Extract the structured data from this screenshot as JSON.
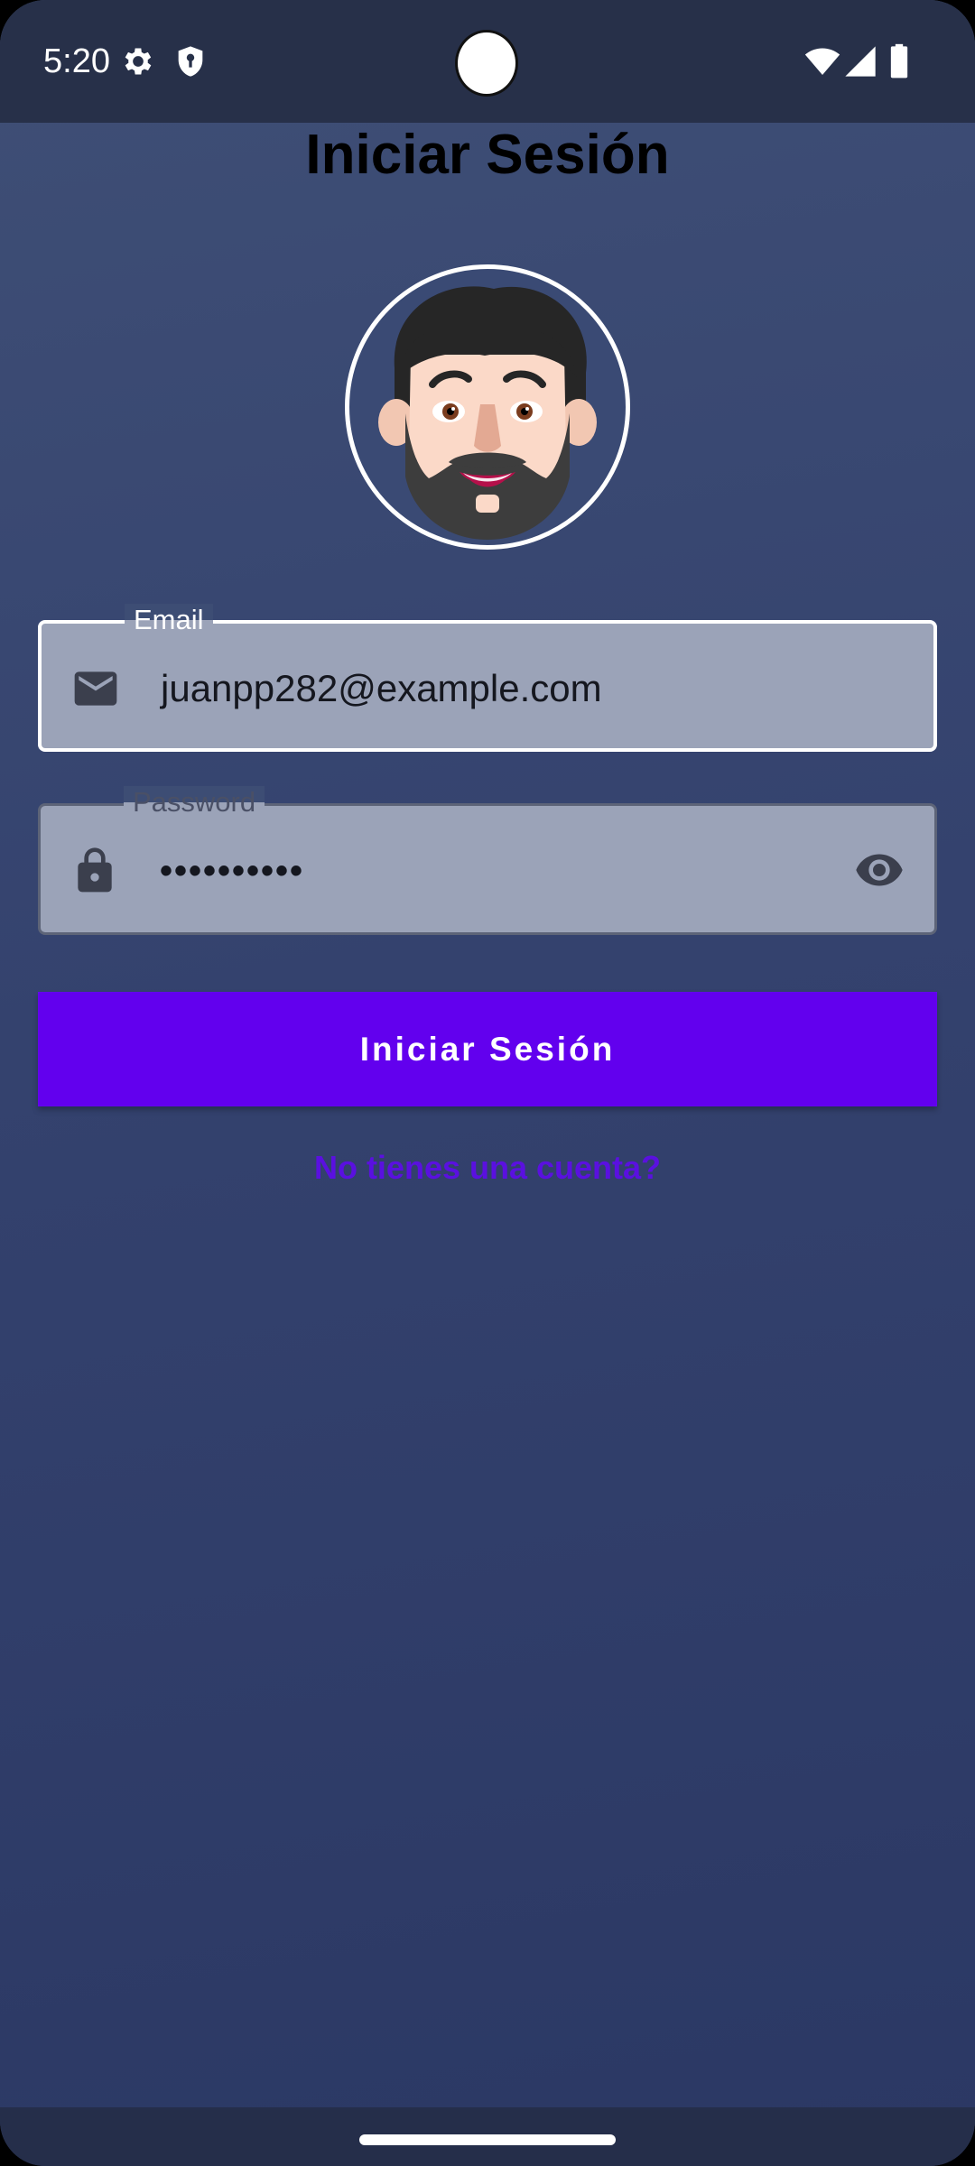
{
  "status_bar": {
    "time": "5:20",
    "icons": [
      "gear-icon",
      "shield-icon",
      "wifi-icon",
      "signal-icon",
      "battery-icon"
    ]
  },
  "page": {
    "title": "Iniciar Sesión"
  },
  "form": {
    "email": {
      "label": "Email",
      "value": "juanpp282@example.com",
      "icon": "email-icon"
    },
    "password": {
      "label": "Password",
      "value": "••••••••••",
      "icon": "lock-icon",
      "toggle_icon": "eye-icon"
    },
    "submit_label": "Iniciar Sesión",
    "signup_link": "No tienes una cuenta?"
  },
  "colors": {
    "primary": "#6200ee",
    "link": "#5a10e0",
    "background_top": "#3f4f76",
    "background_bottom": "#2b3864",
    "field_fill": "#9ba3b8"
  }
}
